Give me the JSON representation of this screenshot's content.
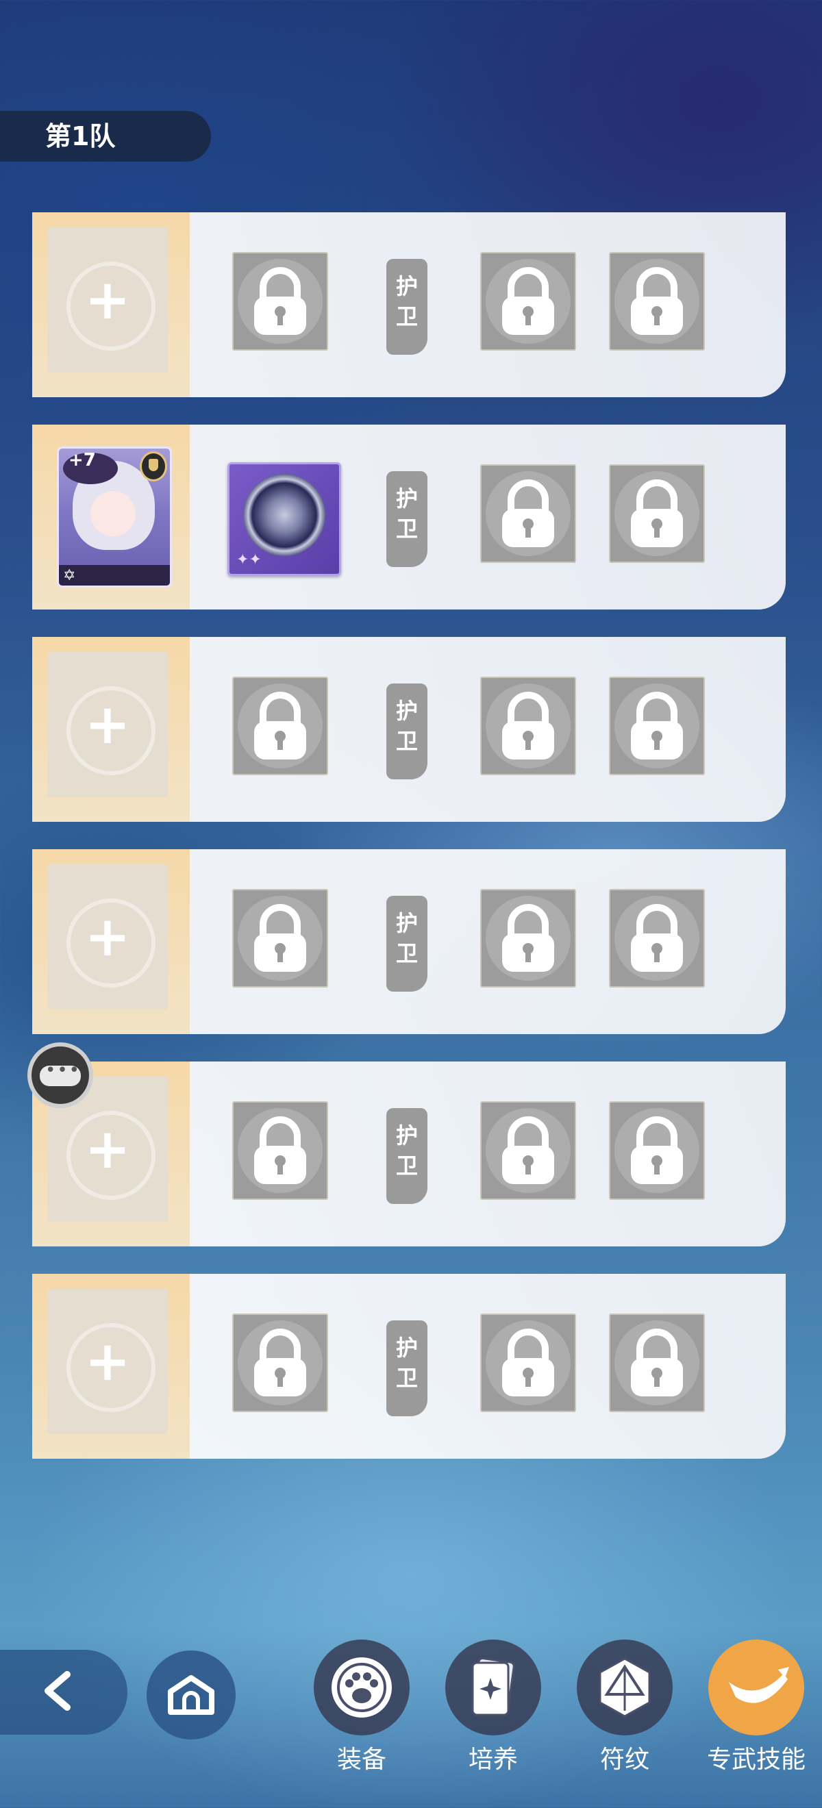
{
  "team": {
    "label": "第1队"
  },
  "rows": [
    {
      "occupied": false,
      "guard_label": "护卫"
    },
    {
      "occupied": true,
      "guard_label": "护卫",
      "hero": {
        "level": "+7"
      }
    },
    {
      "occupied": false,
      "guard_label": "护卫"
    },
    {
      "occupied": false,
      "guard_label": "护卫"
    },
    {
      "occupied": false,
      "guard_label": "护卫"
    },
    {
      "occupied": false,
      "guard_label": "护卫"
    }
  ],
  "toolbar": {
    "equip_label": "装备",
    "train_label": "培养",
    "rune_label": "符纹",
    "exclusive_skill_label": "专武技能"
  },
  "empty_slot": {
    "plus": "+"
  },
  "colors": {
    "active": "#f0a647",
    "panel": "#f3f4f7",
    "slot_bg": "#f6d8a8"
  }
}
